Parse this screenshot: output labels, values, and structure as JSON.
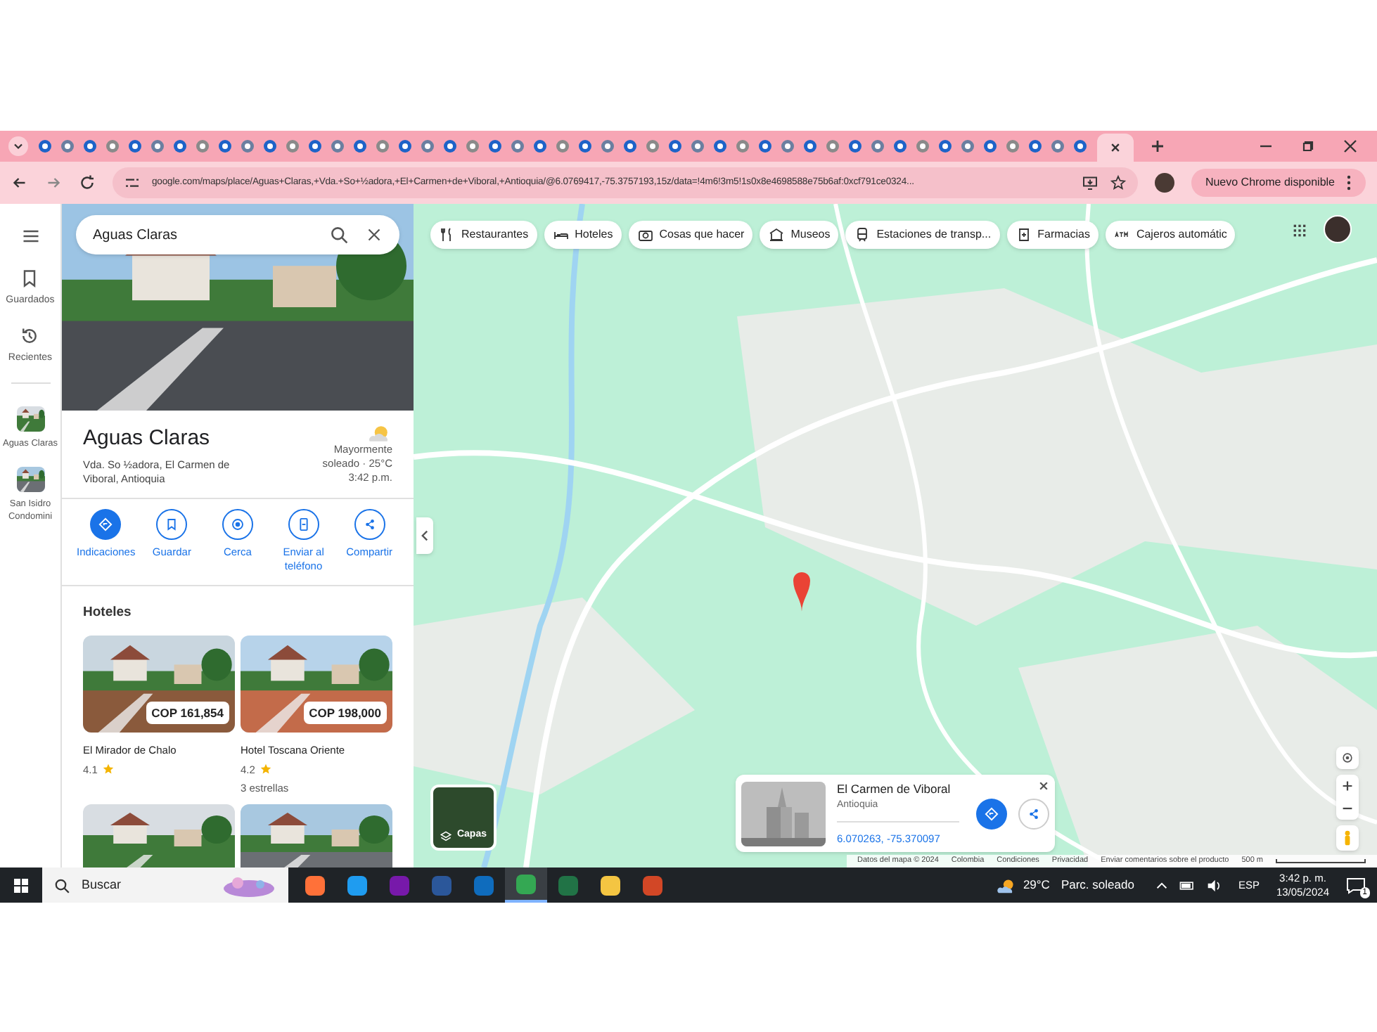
{
  "browser": {
    "tabs": [
      {
        "selected": false
      },
      {
        "selected": false
      },
      {
        "selected": false
      },
      {
        "selected": false
      },
      {
        "selected": false
      },
      {
        "selected": false
      },
      {
        "selected": false
      },
      {
        "selected": false
      },
      {
        "selected": false
      },
      {
        "selected": false
      },
      {
        "selected": false
      },
      {
        "selected": false
      },
      {
        "selected": false
      },
      {
        "selected": false
      },
      {
        "selected": false
      },
      {
        "selected": false
      },
      {
        "selected": false
      },
      {
        "selected": false
      },
      {
        "selected": false
      },
      {
        "selected": false
      },
      {
        "selected": false
      },
      {
        "selected": false
      },
      {
        "selected": false
      },
      {
        "selected": false
      },
      {
        "selected": false
      },
      {
        "selected": false
      },
      {
        "selected": false
      },
      {
        "selected": false
      },
      {
        "selected": false
      },
      {
        "selected": false
      },
      {
        "selected": false
      },
      {
        "selected": false
      },
      {
        "selected": false
      },
      {
        "selected": false
      },
      {
        "selected": false
      },
      {
        "selected": false
      },
      {
        "selected": false
      },
      {
        "selected": false
      },
      {
        "selected": false
      },
      {
        "selected": false
      },
      {
        "selected": false
      },
      {
        "selected": false
      },
      {
        "selected": false
      },
      {
        "selected": false
      },
      {
        "selected": false
      },
      {
        "selected": false
      },
      {
        "selected": false
      },
      {
        "selected": true
      }
    ],
    "url": "google.com/maps/place/Aguas+Claras,+Vda.+So+½adora,+El+Carmen+de+Viboral,+Antioquia/@6.0769417,-75.3757193,15z/data=!4m6!3m5!1s0x8e4698588e75b6af:0xcf791ce0324...",
    "update_button": "Nuevo Chrome disponible"
  },
  "rail": {
    "items": [
      {
        "label": "Guardados",
        "kind": "bookmark"
      },
      {
        "label": "Recientes",
        "kind": "history"
      }
    ],
    "recent": [
      {
        "label": "Aguas Claras"
      },
      {
        "label": "San Isidro Condomini"
      }
    ]
  },
  "place": {
    "search_value": "Aguas Claras",
    "title": "Aguas Claras",
    "address": "Vda. So ½adora, El Carmen de Viboral, Antioquia",
    "weather": "Mayormente soleado · 25°C",
    "time": "3:42 p.m.",
    "actions": [
      {
        "label": "Indicaciones",
        "kind": "directions",
        "selected": true
      },
      {
        "label": "Guardar",
        "kind": "save",
        "selected": false
      },
      {
        "label": "Cerca",
        "kind": "nearby",
        "selected": false
      },
      {
        "label": "Enviar al teléfono",
        "kind": "phone",
        "selected": false
      },
      {
        "label": "Compartir",
        "kind": "share",
        "selected": false
      }
    ],
    "hotels_title": "Hoteles",
    "hotels": [
      {
        "name": "El Mirador de Chalo",
        "rating": "4.1",
        "price": "COP 161,854"
      },
      {
        "name": "Hotel Toscana Oriente",
        "rating": "4.2",
        "price": "COP 198,000",
        "class": "3 estrellas"
      }
    ]
  },
  "map": {
    "chips": [
      {
        "label": "Restaurantes",
        "kind": "food"
      },
      {
        "label": "Hoteles",
        "kind": "bed"
      },
      {
        "label": "Cosas que hacer",
        "kind": "camera"
      },
      {
        "label": "Museos",
        "kind": "museum"
      },
      {
        "label": "Estaciones de transp...",
        "kind": "train"
      },
      {
        "label": "Farmacias",
        "kind": "pharmacy"
      },
      {
        "label": "Cajeros automátic",
        "kind": "atm"
      }
    ],
    "layers_label": "Capas",
    "card": {
      "title": "El Carmen de Viboral",
      "subtitle": "Antioquia",
      "coords": "6.070263, -75.370097"
    },
    "footer": [
      "Datos del mapa © 2024",
      "Colombia",
      "Condiciones",
      "Privacidad",
      "Enviar comentarios sobre el producto"
    ],
    "scale": "500 m"
  },
  "taskbar": {
    "search": "Buscar",
    "apps": [
      {
        "kind": "firefox",
        "selected": false
      },
      {
        "kind": "edge",
        "selected": false
      },
      {
        "kind": "onenote",
        "selected": false
      },
      {
        "kind": "word",
        "selected": false
      },
      {
        "kind": "app",
        "selected": false
      },
      {
        "kind": "chrome",
        "selected": true
      },
      {
        "kind": "excel",
        "selected": false
      },
      {
        "kind": "files",
        "selected": false
      },
      {
        "kind": "powerpoint",
        "selected": false
      }
    ],
    "temp": "29°C",
    "weather": "Parc. soleado",
    "lang": "ESP",
    "time": "3:42 p. m.",
    "date": "13/05/2024",
    "notifications": "1"
  }
}
